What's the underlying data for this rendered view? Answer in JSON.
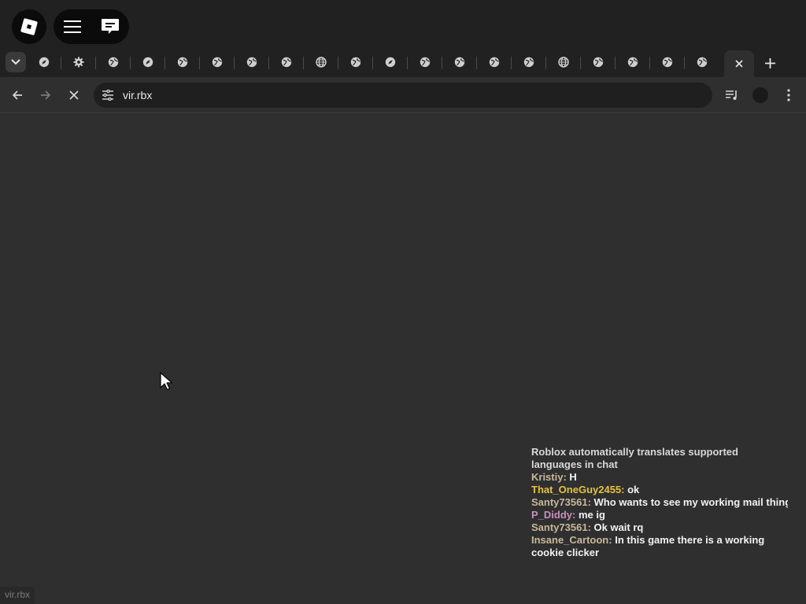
{
  "window": {
    "colors": {
      "bg": "#2f2f2f",
      "bar": "#212121"
    }
  },
  "topbar": {
    "logo_icon": "roblox-logo-icon",
    "menu_icon": "hamburger-menu-icon",
    "chat_icon": "chat-bubble-icon"
  },
  "tabs": {
    "dropdown_icon": "chevron-down-icon",
    "icons": [
      "compass-icon",
      "gear-icon",
      "globe-icon",
      "compass-icon",
      "globe-icon",
      "globe-icon",
      "globe-icon",
      "globe-icon",
      "globe-grid-icon",
      "globe-icon",
      "compass-icon",
      "globe-icon",
      "globe-icon",
      "globe-icon",
      "globe-icon",
      "globe-grid-icon",
      "globe-icon",
      "globe-icon",
      "globe-icon",
      "globe-icon"
    ],
    "active_close_icon": "close-icon",
    "new_tab_icon": "plus-icon"
  },
  "toolbar": {
    "url": "vir.rbx",
    "back_icon": "arrow-left-icon",
    "forward_icon": "arrow-right-icon",
    "stop_icon": "close-icon",
    "site_settings_icon": "tune-icon",
    "media_icon": "playlist-icon",
    "profile_icon": "profile-avatar",
    "menu_icon": "kebab-menu-icon"
  },
  "chat": {
    "system": "Roblox automatically translates supported languages in chat",
    "messages": [
      {
        "user": "Kristiy",
        "sep": ": ",
        "text": "H",
        "color": "#c8b89a"
      },
      {
        "user": "That_OneGuy2455",
        "sep": ": ",
        "text": "ok",
        "color": "#e6c23c"
      },
      {
        "user": "Santy73561",
        "sep": ": ",
        "text": "Who wants to see my working mail thing",
        "color": "#c8b89a"
      },
      {
        "user": "P_Diddy",
        "sep": ": ",
        "text": "me ig",
        "color": "#c98fbf"
      },
      {
        "user": "Santy73561",
        "sep": ": ",
        "text": "Ok wait rq",
        "color": "#c8b89a"
      },
      {
        "user": "Insane_Cartoon",
        "sep": ": ",
        "text": "In this game there is a working cookie clicker",
        "color": "#c8b89a"
      }
    ]
  },
  "status_bar": {
    "url": "vir.rbx"
  }
}
